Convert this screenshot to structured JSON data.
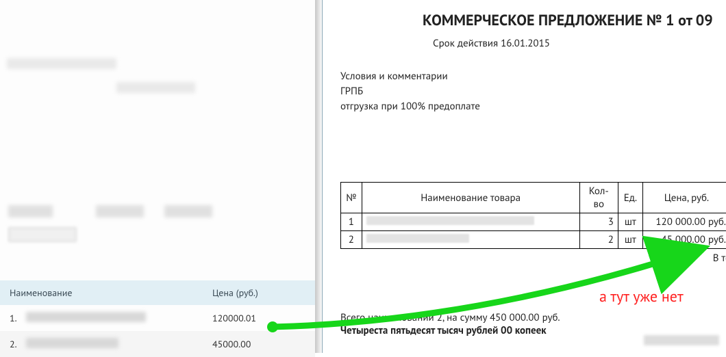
{
  "leftTable": {
    "headers": {
      "name": "Наименование",
      "price": "Цена (руб.)"
    },
    "rows": [
      {
        "idx": "1.",
        "price": "120000.01"
      },
      {
        "idx": "2.",
        "price": "45000.00"
      }
    ]
  },
  "doc": {
    "title": "КОММЕРЧЕСКОЕ ПРЕДЛОЖЕНИЕ № 1 от 09",
    "validPrefix": "Срок действия ",
    "validDate": "16.01.2015",
    "conditionsHeader": "Условия и комментарии",
    "grps": "ГРПБ",
    "shipping": "отгрузка при 100% предоплате",
    "tableHeaders": {
      "num": "№",
      "name": "Наименование товара",
      "qty": "Кол-во",
      "unit": "Ед.",
      "price": "Цена, руб."
    },
    "rows": [
      {
        "num": "1",
        "qty": "3",
        "unit": "шт",
        "price": "120 000.00 руб."
      },
      {
        "num": "2",
        "qty": "2",
        "unit": "шт",
        "price": "45 000.00 руб."
      }
    ],
    "afterTable": "В то",
    "totalLine": "Всего наименований 2, на сумму 450 000.00 руб.",
    "totalWords": "Четыреста пятьдесят тысяч рублей 00 копеек"
  },
  "annotation": "а тут уже нет"
}
